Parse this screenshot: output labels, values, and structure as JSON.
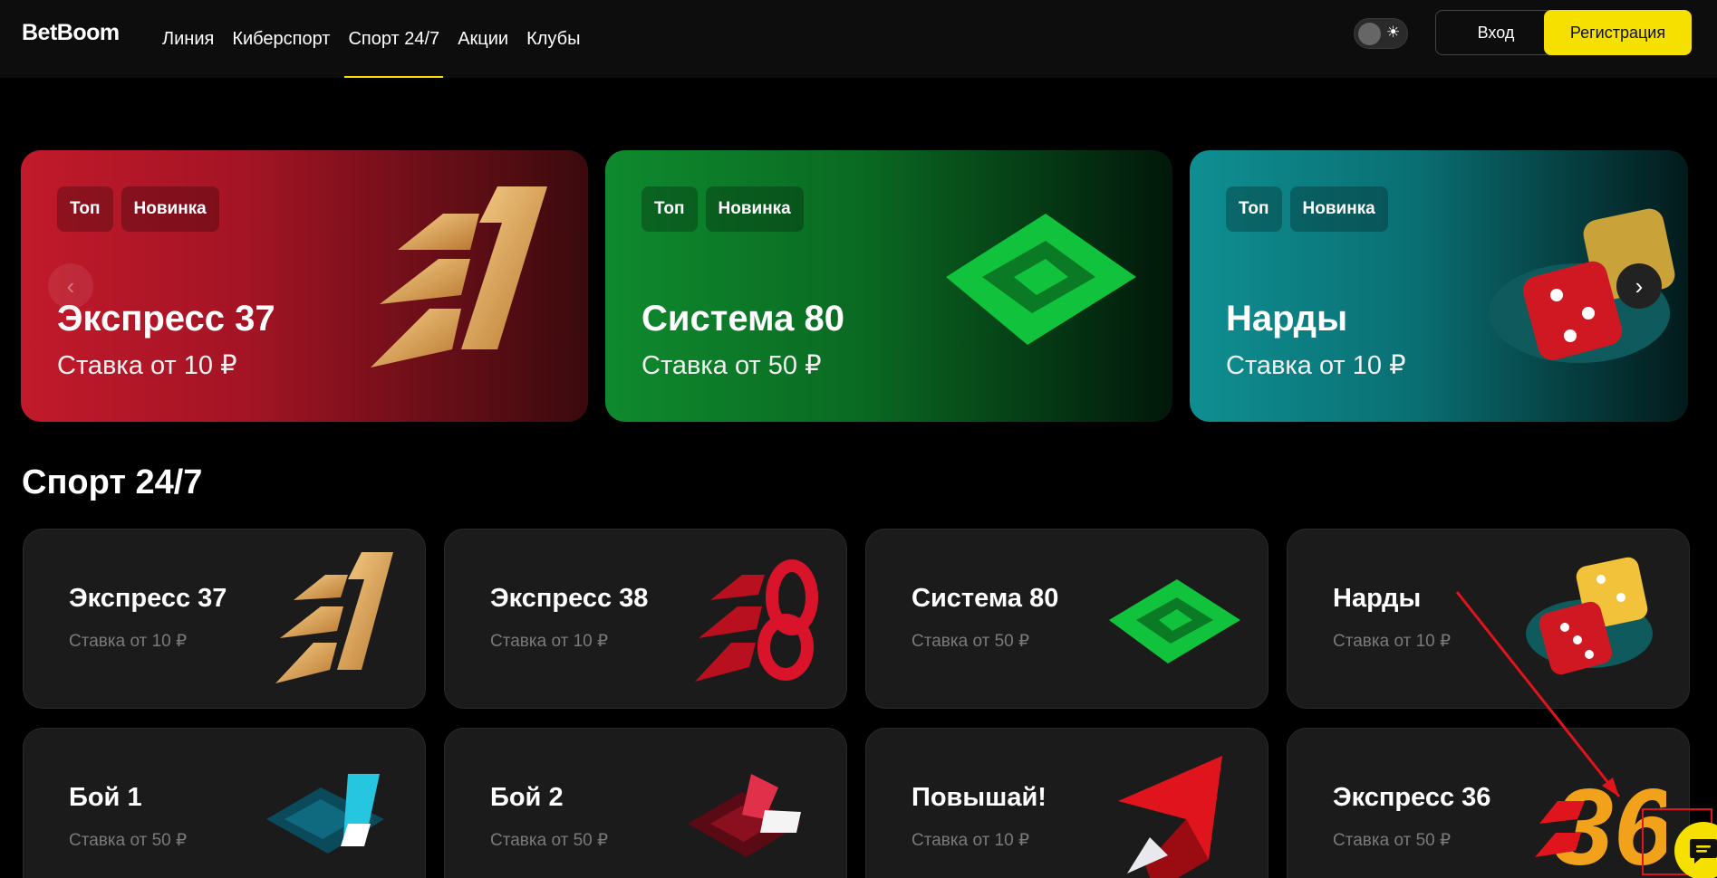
{
  "header": {
    "logo": "BetBoom",
    "nav": [
      "Линия",
      "Киберспорт",
      "Спорт 24/7",
      "Акции",
      "Клубы"
    ],
    "active_nav": "Спорт 24/7",
    "login_label": "Вход",
    "register_label": "Регистрация",
    "toggle_icon": "sun-icon"
  },
  "banners": [
    {
      "tags": [
        "Топ",
        "Новинка"
      ],
      "title": "Экспресс 37",
      "subtitle": "Ставка от 10 ₽"
    },
    {
      "tags": [
        "Топ",
        "Новинка"
      ],
      "title": "Система 80",
      "subtitle": "Ставка от 50 ₽"
    },
    {
      "tags": [
        "Топ",
        "Новинка"
      ],
      "title": "Нарды",
      "subtitle": "Ставка от 10 ₽"
    }
  ],
  "section": {
    "title": "Спорт 24/7"
  },
  "games": [
    {
      "title": "Экспресс 37",
      "subtitle": "Ставка от 10 ₽"
    },
    {
      "title": "Экспресс 38",
      "subtitle": "Ставка от 10 ₽"
    },
    {
      "title": "Система 80",
      "subtitle": "Ставка от 50 ₽"
    },
    {
      "title": "Нарды",
      "subtitle": "Ставка от 10 ₽"
    },
    {
      "title": "Бой 1",
      "subtitle": "Ставка от 50 ₽"
    },
    {
      "title": "Бой 2",
      "subtitle": "Ставка от 50 ₽"
    },
    {
      "title": "Повышай!",
      "subtitle": "Ставка от 10 ₽"
    },
    {
      "title": "Экспресс 36",
      "subtitle": "Ставка от 50 ₽"
    }
  ],
  "colors": {
    "accent": "#f5e000",
    "background": "#000000",
    "card": "#1b1b1b",
    "annotation": "#e0141c"
  }
}
